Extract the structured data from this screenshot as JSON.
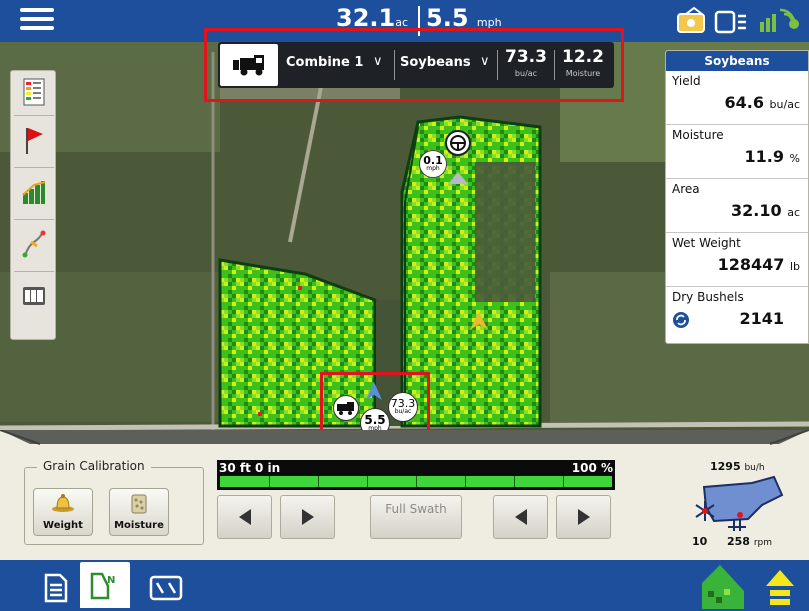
{
  "topbar": {
    "area_value": "32.1",
    "area_unit": "ac",
    "speed_value": "5.5",
    "speed_unit": "mph"
  },
  "status_icons": [
    "antenna-icon",
    "display-icon",
    "gps-icon"
  ],
  "left_toolbar": [
    "legend-icon",
    "flag-icon",
    "chart-icon",
    "guidance-icon",
    "counter-icon"
  ],
  "combine_panel": {
    "combine_name": "Combine 1",
    "crop": "Soybeans",
    "yield_value": "73.3",
    "yield_unit": "bu/ac",
    "moisture_value": "12.2",
    "moisture_label": "Moisture"
  },
  "right_panel": {
    "title": "Soybeans",
    "yield_label": "Yield",
    "yield_value": "64.6",
    "yield_unit": "bu/ac",
    "moisture_label": "Moisture",
    "moisture_value": "11.9",
    "moisture_unit": "%",
    "area_label": "Area",
    "area_value": "32.10",
    "area_unit": "ac",
    "wet_weight_label": "Wet Weight",
    "wet_weight_value": "128447",
    "wet_weight_unit": "lb",
    "dry_bushels_label": "Dry Bushels",
    "dry_bushels_value": "2141"
  },
  "map_markers": {
    "other_combine_speed": "0.1",
    "other_combine_unit": "mph",
    "my_speed": "5.5",
    "my_speed_unit": "mph",
    "my_yield": "73.3",
    "my_yield_unit": "bu/ac"
  },
  "grain_calibration": {
    "title": "Grain Calibration",
    "weight_label": "Weight",
    "moisture_label": "Moisture"
  },
  "swath": {
    "width": "30 ft 0 in",
    "percent": "100 %",
    "full_swath_label": "Full Swath",
    "coverage_fraction": 1.0
  },
  "machine": {
    "flow_rate": "1295",
    "flow_unit": "bu/h",
    "fan_rpm": "10",
    "rotor_rpm": "258",
    "rpm_unit": "rpm"
  },
  "colors": {
    "brand_blue": "#1d4f9c",
    "highlight_red": "#e0141c",
    "coverage_green": "#3ed63a",
    "yield_yellow_green": "#c9f21a"
  }
}
